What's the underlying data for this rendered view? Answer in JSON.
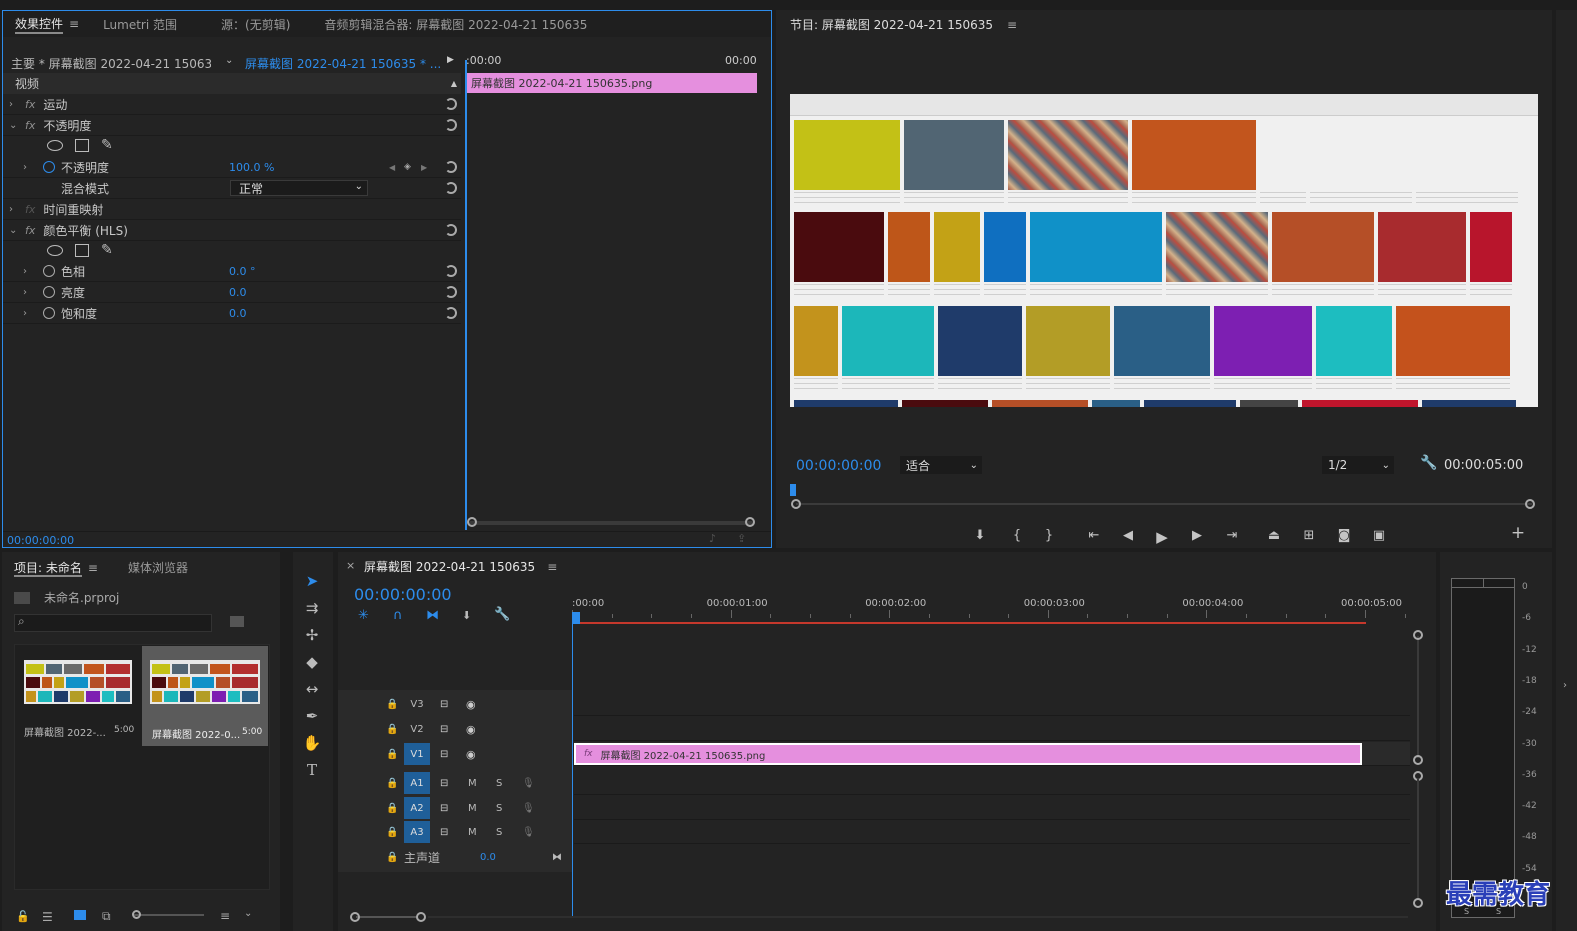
{
  "effect_controls": {
    "tabs": [
      "效果控件",
      "Lumetri 范围",
      "源：(无剪辑)",
      "音频剪辑混合器: 屏幕截图 2022-04-21 150635"
    ],
    "menu_glyph": "≡",
    "master_label": "主要 * 屏幕截图 2022-04-21 150635...",
    "clip_selector": "屏幕截图 2022-04-21 150635 * ...",
    "time_start": ":00:00",
    "time_end": "00:00",
    "section_video": "视频",
    "clip_bar_label": "屏幕截图 2022-04-21  150635.png",
    "fx_label": "fx",
    "effects": {
      "motion": "运动",
      "opacity": "不透明度",
      "opacity_param": "不透明度",
      "opacity_value": "100.0 %",
      "blend_mode": "混合模式",
      "blend_value": "正常",
      "time_remap": "时间重映射",
      "color_balance": "颜色平衡 (HLS)",
      "hue": "色相",
      "hue_value": "0.0 °",
      "lightness": "亮度",
      "lightness_value": "0.0",
      "saturation": "饱和度",
      "saturation_value": "0.0"
    },
    "footer_time": "00:00:00:00"
  },
  "program": {
    "title": "节目: 屏幕截图 2022-04-21 150635",
    "menu_glyph": "≡",
    "timecode": "00:00:00:00",
    "fit": "适合",
    "resolution": "1/2",
    "duration": "00:00:05:00",
    "add": "+",
    "colors": {
      "row1": [
        "#c3c116",
        "#516573",
        "#photo",
        "#c2551d",
        "#poster",
        "#photo2",
        "#photo3"
      ],
      "row2": [
        "#4a0b0e",
        "#be5619",
        "#c3a216",
        "#0f6fc0",
        "#1091c8",
        "#cartoon",
        "#b54f27",
        "#a82b2e",
        "#b8152c"
      ],
      "row3": [
        "#c3931c",
        "#1cb7ba",
        "#1f3b6a",
        "#b39d26",
        "#2a5f86",
        "#7d1fb2",
        "#1dbdc0",
        "#c4521c"
      ]
    }
  },
  "project": {
    "tabs": [
      "项目: 未命名",
      "媒体浏览器"
    ],
    "menu_glyph": "≡",
    "file": "未命名.prproj",
    "search_placeholder": "",
    "items": [
      {
        "name": "屏幕截图 2022-...",
        "dur": "5:00"
      },
      {
        "name": "屏幕截图 2022-0...",
        "dur": "5:00"
      }
    ]
  },
  "timeline": {
    "close": "×",
    "title": "屏幕截图 2022-04-21 150635",
    "menu_glyph": "≡",
    "timecode": "00:00:00:00",
    "ruler": [
      ":00:00",
      "00:00:01:00",
      "00:00:02:00",
      "00:00:03:00",
      "00:00:04:00",
      "00:00:05:00"
    ],
    "video_tracks": [
      "V3",
      "V2",
      "V1"
    ],
    "audio_tracks": [
      "A1",
      "A2",
      "A3"
    ],
    "mute": "M",
    "solo": "S",
    "master": "主声道",
    "master_value": "0.0",
    "clip_label": "屏幕截图 2022-04-21  150635.png",
    "clip_fx": "fx"
  },
  "meter": {
    "scale": [
      "0",
      "-6",
      "-12",
      "-18",
      "-24",
      "-30",
      "-36",
      "-42",
      "-48",
      "-54"
    ],
    "solo_labels": [
      "S",
      "S"
    ]
  },
  "watermark": "最需教育"
}
